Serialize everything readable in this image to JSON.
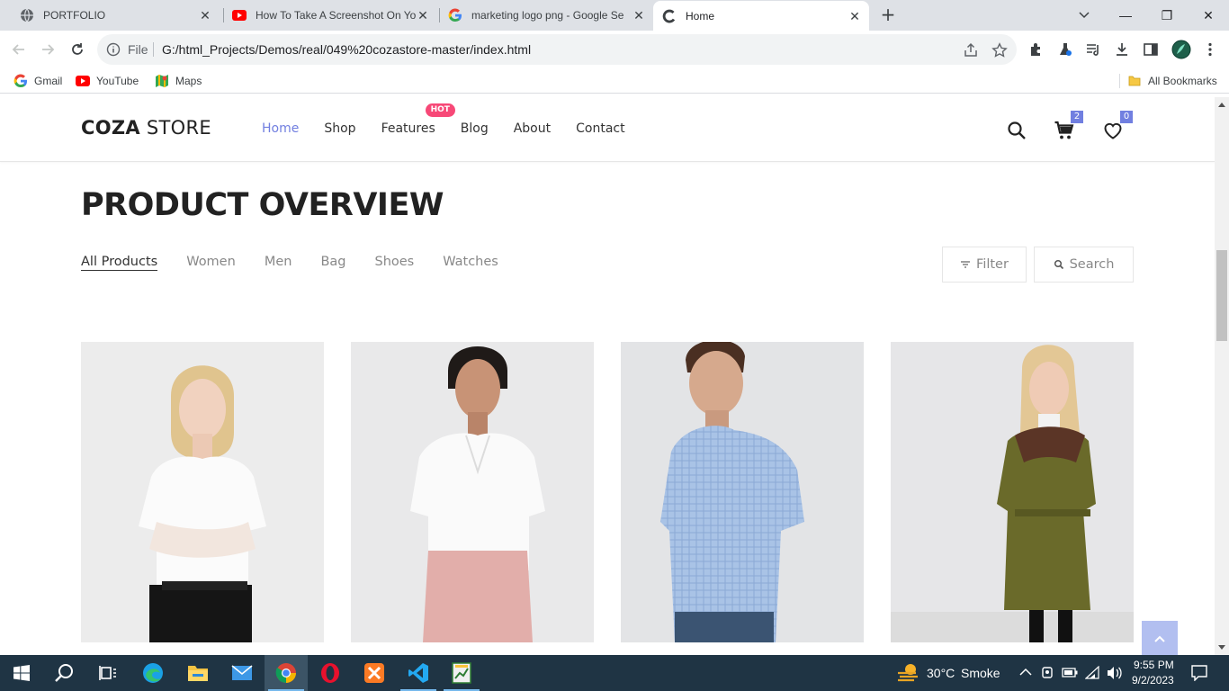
{
  "browser": {
    "tabs": [
      {
        "title": "PORTFOLIO",
        "icon": "globe-icon",
        "active": false
      },
      {
        "title": "How To Take A Screenshot On Yo",
        "icon": "youtube-icon",
        "active": false
      },
      {
        "title": "marketing logo png - Google Se",
        "icon": "google-icon",
        "active": false
      },
      {
        "title": "Home",
        "icon": "loading-icon",
        "active": true
      }
    ],
    "new_tab_label": "+",
    "window_controls": {
      "minimize": "—",
      "restore": "❐",
      "close": "✕"
    },
    "address": {
      "scheme_label": "File",
      "url": "G:/html_Projects/Demos/real/049%20cozastore-master/index.html"
    },
    "bookmarks": [
      {
        "label": "Gmail",
        "icon": "google-icon"
      },
      {
        "label": "YouTube",
        "icon": "youtube-icon"
      },
      {
        "label": "Maps",
        "icon": "maps-icon"
      }
    ],
    "all_bookmarks_label": "All Bookmarks"
  },
  "site": {
    "logo_bold": "COZA",
    "logo_light": " STORE",
    "nav": [
      {
        "label": "Home",
        "active": true
      },
      {
        "label": "Shop",
        "active": false
      },
      {
        "label": "Features",
        "active": false,
        "badge": "HOT"
      },
      {
        "label": "Blog",
        "active": false
      },
      {
        "label": "About",
        "active": false
      },
      {
        "label": "Contact",
        "active": false
      }
    ],
    "cart_count": "2",
    "wishlist_count": "0",
    "accent_color": "#717fe0",
    "hot_color": "#f74877"
  },
  "overview": {
    "title": "PRODUCT OVERVIEW",
    "filters": [
      "All Products",
      "Women",
      "Men",
      "Bag",
      "Shoes",
      "Watches"
    ],
    "active_filter": "All Products",
    "filter_button": "Filter",
    "search_button": "Search"
  },
  "products": [
    {
      "name": "woman-white-tee",
      "icon": "product-image"
    },
    {
      "name": "woman-white-shirt",
      "icon": "product-image"
    },
    {
      "name": "man-blue-shirt",
      "icon": "product-image"
    },
    {
      "name": "woman-olive-coat",
      "icon": "product-image"
    }
  ],
  "taskbar": {
    "weather_temp": "30°C",
    "weather_text": "Smoke",
    "time": "9:55 PM",
    "date": "9/2/2023"
  }
}
